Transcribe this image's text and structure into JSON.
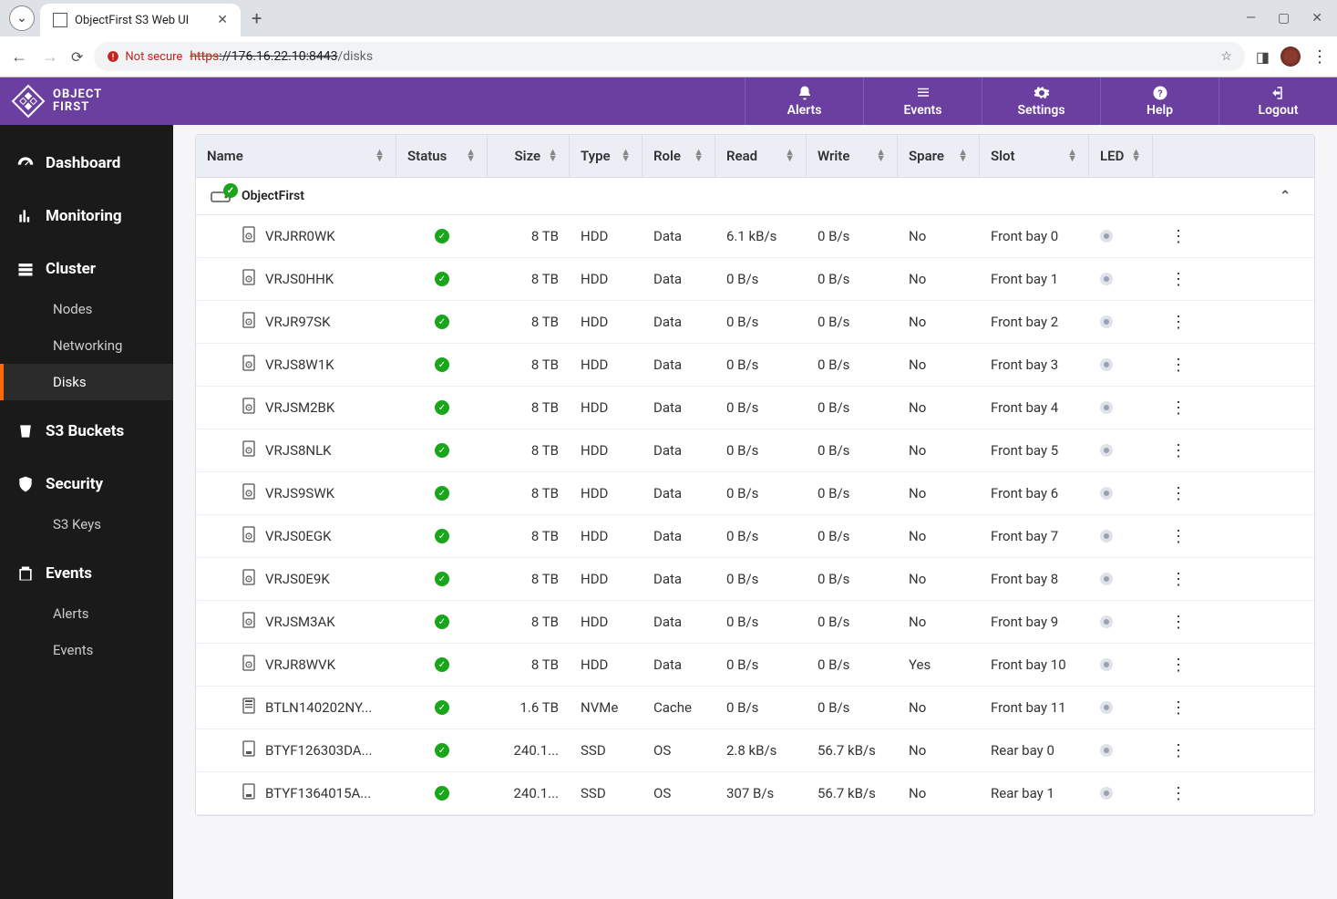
{
  "browser": {
    "tab_title": "ObjectFirst S3 Web UI",
    "not_secure_label": "Not secure",
    "url_scheme": "https",
    "url_host": "://176.16.22.10:8443",
    "url_path": "/disks"
  },
  "brand": {
    "line1": "OBJECT",
    "line2": "FIRST"
  },
  "header": {
    "alerts": "Alerts",
    "events": "Events",
    "settings": "Settings",
    "help": "Help",
    "logout": "Logout"
  },
  "sidebar": {
    "dashboard": "Dashboard",
    "monitoring": "Monitoring",
    "cluster": "Cluster",
    "nodes": "Nodes",
    "networking": "Networking",
    "disks": "Disks",
    "s3buckets": "S3 Buckets",
    "security": "Security",
    "s3keys": "S3 Keys",
    "events": "Events",
    "alerts": "Alerts",
    "events_sub": "Events"
  },
  "table": {
    "cols": {
      "name": "Name",
      "status": "Status",
      "size": "Size",
      "type": "Type",
      "role": "Role",
      "read": "Read",
      "write": "Write",
      "spare": "Spare",
      "slot": "Slot",
      "led": "LED"
    },
    "group": "ObjectFirst",
    "rows": [
      {
        "name": "VRJRR0WK",
        "size": "8 TB",
        "type": "HDD",
        "role": "Data",
        "read": "6.1 kB/s",
        "write": "0 B/s",
        "spare": "No",
        "slot": "Front bay 0",
        "kind": "hdd"
      },
      {
        "name": "VRJS0HHK",
        "size": "8 TB",
        "type": "HDD",
        "role": "Data",
        "read": "0 B/s",
        "write": "0 B/s",
        "spare": "No",
        "slot": "Front bay 1",
        "kind": "hdd"
      },
      {
        "name": "VRJR97SK",
        "size": "8 TB",
        "type": "HDD",
        "role": "Data",
        "read": "0 B/s",
        "write": "0 B/s",
        "spare": "No",
        "slot": "Front bay 2",
        "kind": "hdd"
      },
      {
        "name": "VRJS8W1K",
        "size": "8 TB",
        "type": "HDD",
        "role": "Data",
        "read": "0 B/s",
        "write": "0 B/s",
        "spare": "No",
        "slot": "Front bay 3",
        "kind": "hdd"
      },
      {
        "name": "VRJSM2BK",
        "size": "8 TB",
        "type": "HDD",
        "role": "Data",
        "read": "0 B/s",
        "write": "0 B/s",
        "spare": "No",
        "slot": "Front bay 4",
        "kind": "hdd"
      },
      {
        "name": "VRJS8NLK",
        "size": "8 TB",
        "type": "HDD",
        "role": "Data",
        "read": "0 B/s",
        "write": "0 B/s",
        "spare": "No",
        "slot": "Front bay 5",
        "kind": "hdd"
      },
      {
        "name": "VRJS9SWK",
        "size": "8 TB",
        "type": "HDD",
        "role": "Data",
        "read": "0 B/s",
        "write": "0 B/s",
        "spare": "No",
        "slot": "Front bay 6",
        "kind": "hdd"
      },
      {
        "name": "VRJS0EGK",
        "size": "8 TB",
        "type": "HDD",
        "role": "Data",
        "read": "0 B/s",
        "write": "0 B/s",
        "spare": "No",
        "slot": "Front bay 7",
        "kind": "hdd"
      },
      {
        "name": "VRJS0E9K",
        "size": "8 TB",
        "type": "HDD",
        "role": "Data",
        "read": "0 B/s",
        "write": "0 B/s",
        "spare": "No",
        "slot": "Front bay 8",
        "kind": "hdd"
      },
      {
        "name": "VRJSM3AK",
        "size": "8 TB",
        "type": "HDD",
        "role": "Data",
        "read": "0 B/s",
        "write": "0 B/s",
        "spare": "No",
        "slot": "Front bay 9",
        "kind": "hdd"
      },
      {
        "name": "VRJR8WVK",
        "size": "8 TB",
        "type": "HDD",
        "role": "Data",
        "read": "0 B/s",
        "write": "0 B/s",
        "spare": "Yes",
        "slot": "Front bay 10",
        "kind": "hdd"
      },
      {
        "name": "BTLN140202NY...",
        "size": "1.6 TB",
        "type": "NVMe",
        "role": "Cache",
        "read": "0 B/s",
        "write": "0 B/s",
        "spare": "No",
        "slot": "Front bay 11",
        "kind": "nvme"
      },
      {
        "name": "BTYF126303DA...",
        "size": "240.1...",
        "type": "SSD",
        "role": "OS",
        "read": "2.8 kB/s",
        "write": "56.7 kB/s",
        "spare": "No",
        "slot": "Rear bay 0",
        "kind": "ssd"
      },
      {
        "name": "BTYF1364015A...",
        "size": "240.1...",
        "type": "SSD",
        "role": "OS",
        "read": "307 B/s",
        "write": "56.7 kB/s",
        "spare": "No",
        "slot": "Rear bay 1",
        "kind": "ssd"
      }
    ]
  }
}
